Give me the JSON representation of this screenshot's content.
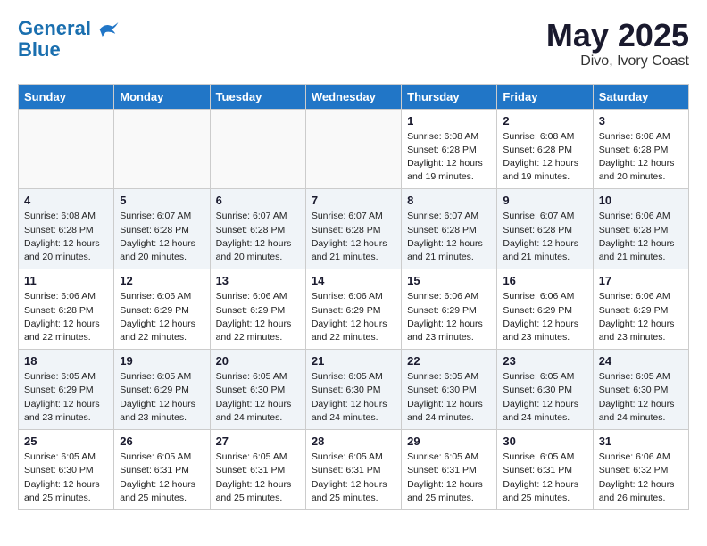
{
  "header": {
    "logo_line1": "General",
    "logo_line2": "Blue",
    "month_year": "May 2025",
    "location": "Divo, Ivory Coast"
  },
  "days_of_week": [
    "Sunday",
    "Monday",
    "Tuesday",
    "Wednesday",
    "Thursday",
    "Friday",
    "Saturday"
  ],
  "weeks": [
    [
      {
        "num": "",
        "info": ""
      },
      {
        "num": "",
        "info": ""
      },
      {
        "num": "",
        "info": ""
      },
      {
        "num": "",
        "info": ""
      },
      {
        "num": "1",
        "info": "Sunrise: 6:08 AM\nSunset: 6:28 PM\nDaylight: 12 hours\nand 19 minutes."
      },
      {
        "num": "2",
        "info": "Sunrise: 6:08 AM\nSunset: 6:28 PM\nDaylight: 12 hours\nand 19 minutes."
      },
      {
        "num": "3",
        "info": "Sunrise: 6:08 AM\nSunset: 6:28 PM\nDaylight: 12 hours\nand 20 minutes."
      }
    ],
    [
      {
        "num": "4",
        "info": "Sunrise: 6:08 AM\nSunset: 6:28 PM\nDaylight: 12 hours\nand 20 minutes."
      },
      {
        "num": "5",
        "info": "Sunrise: 6:07 AM\nSunset: 6:28 PM\nDaylight: 12 hours\nand 20 minutes."
      },
      {
        "num": "6",
        "info": "Sunrise: 6:07 AM\nSunset: 6:28 PM\nDaylight: 12 hours\nand 20 minutes."
      },
      {
        "num": "7",
        "info": "Sunrise: 6:07 AM\nSunset: 6:28 PM\nDaylight: 12 hours\nand 21 minutes."
      },
      {
        "num": "8",
        "info": "Sunrise: 6:07 AM\nSunset: 6:28 PM\nDaylight: 12 hours\nand 21 minutes."
      },
      {
        "num": "9",
        "info": "Sunrise: 6:07 AM\nSunset: 6:28 PM\nDaylight: 12 hours\nand 21 minutes."
      },
      {
        "num": "10",
        "info": "Sunrise: 6:06 AM\nSunset: 6:28 PM\nDaylight: 12 hours\nand 21 minutes."
      }
    ],
    [
      {
        "num": "11",
        "info": "Sunrise: 6:06 AM\nSunset: 6:28 PM\nDaylight: 12 hours\nand 22 minutes."
      },
      {
        "num": "12",
        "info": "Sunrise: 6:06 AM\nSunset: 6:29 PM\nDaylight: 12 hours\nand 22 minutes."
      },
      {
        "num": "13",
        "info": "Sunrise: 6:06 AM\nSunset: 6:29 PM\nDaylight: 12 hours\nand 22 minutes."
      },
      {
        "num": "14",
        "info": "Sunrise: 6:06 AM\nSunset: 6:29 PM\nDaylight: 12 hours\nand 22 minutes."
      },
      {
        "num": "15",
        "info": "Sunrise: 6:06 AM\nSunset: 6:29 PM\nDaylight: 12 hours\nand 23 minutes."
      },
      {
        "num": "16",
        "info": "Sunrise: 6:06 AM\nSunset: 6:29 PM\nDaylight: 12 hours\nand 23 minutes."
      },
      {
        "num": "17",
        "info": "Sunrise: 6:06 AM\nSunset: 6:29 PM\nDaylight: 12 hours\nand 23 minutes."
      }
    ],
    [
      {
        "num": "18",
        "info": "Sunrise: 6:05 AM\nSunset: 6:29 PM\nDaylight: 12 hours\nand 23 minutes."
      },
      {
        "num": "19",
        "info": "Sunrise: 6:05 AM\nSunset: 6:29 PM\nDaylight: 12 hours\nand 23 minutes."
      },
      {
        "num": "20",
        "info": "Sunrise: 6:05 AM\nSunset: 6:30 PM\nDaylight: 12 hours\nand 24 minutes."
      },
      {
        "num": "21",
        "info": "Sunrise: 6:05 AM\nSunset: 6:30 PM\nDaylight: 12 hours\nand 24 minutes."
      },
      {
        "num": "22",
        "info": "Sunrise: 6:05 AM\nSunset: 6:30 PM\nDaylight: 12 hours\nand 24 minutes."
      },
      {
        "num": "23",
        "info": "Sunrise: 6:05 AM\nSunset: 6:30 PM\nDaylight: 12 hours\nand 24 minutes."
      },
      {
        "num": "24",
        "info": "Sunrise: 6:05 AM\nSunset: 6:30 PM\nDaylight: 12 hours\nand 24 minutes."
      }
    ],
    [
      {
        "num": "25",
        "info": "Sunrise: 6:05 AM\nSunset: 6:30 PM\nDaylight: 12 hours\nand 25 minutes."
      },
      {
        "num": "26",
        "info": "Sunrise: 6:05 AM\nSunset: 6:31 PM\nDaylight: 12 hours\nand 25 minutes."
      },
      {
        "num": "27",
        "info": "Sunrise: 6:05 AM\nSunset: 6:31 PM\nDaylight: 12 hours\nand 25 minutes."
      },
      {
        "num": "28",
        "info": "Sunrise: 6:05 AM\nSunset: 6:31 PM\nDaylight: 12 hours\nand 25 minutes."
      },
      {
        "num": "29",
        "info": "Sunrise: 6:05 AM\nSunset: 6:31 PM\nDaylight: 12 hours\nand 25 minutes."
      },
      {
        "num": "30",
        "info": "Sunrise: 6:05 AM\nSunset: 6:31 PM\nDaylight: 12 hours\nand 25 minutes."
      },
      {
        "num": "31",
        "info": "Sunrise: 6:06 AM\nSunset: 6:32 PM\nDaylight: 12 hours\nand 26 minutes."
      }
    ]
  ]
}
